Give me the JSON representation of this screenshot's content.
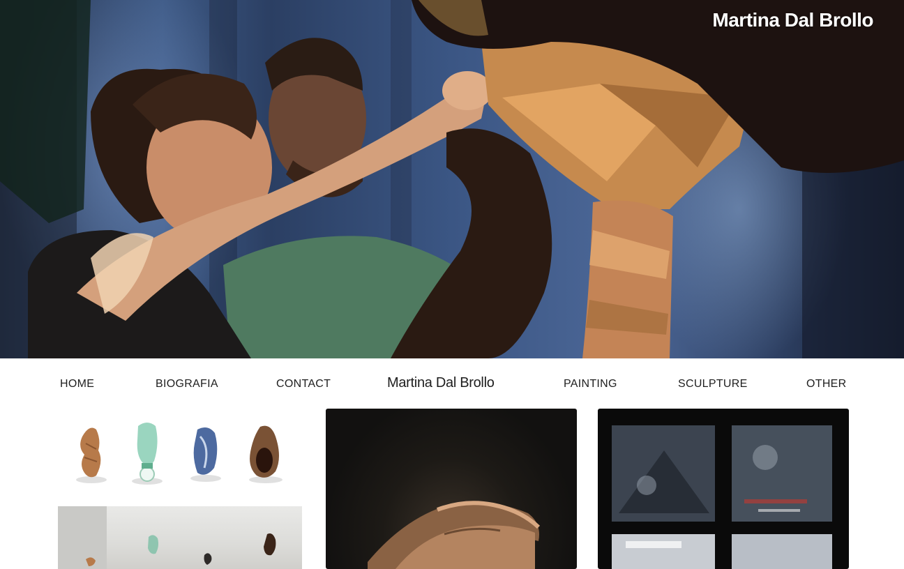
{
  "site": {
    "title": "Martina Dal Brollo"
  },
  "nav": {
    "items": [
      {
        "label": "HOME"
      },
      {
        "label": "BIOGRAFIA"
      },
      {
        "label": "CONTACT"
      },
      {
        "label": "PAINTING"
      },
      {
        "label": "SCULPTURE"
      },
      {
        "label": "OTHER"
      }
    ],
    "brand": "Martina Dal Brollo"
  },
  "hero": {
    "image": "photo-two-artists-assembling-cardboard-sculpture"
  },
  "gallery": {
    "tiles": [
      {
        "image": "four-small-sculptures-objects"
      },
      {
        "image": "sculptures-installation-view"
      },
      {
        "image": "hands-dark-painting"
      },
      {
        "image": "window-panes-photograph"
      }
    ]
  },
  "colors": {
    "background": "#ffffff",
    "text": "#1e1e1e",
    "hero_title": "#ffffff"
  }
}
